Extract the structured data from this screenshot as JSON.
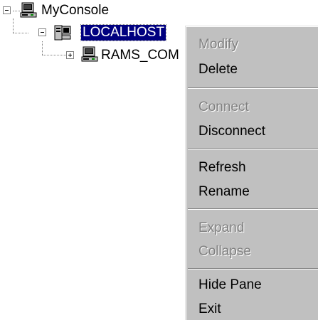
{
  "tree": {
    "root": {
      "label": "MyConsole",
      "expanded": true,
      "icon": "computer-icon"
    },
    "child": {
      "label": "LOCALHOST",
      "expanded": true,
      "selected": true,
      "icon": "server-icon"
    },
    "grandchild": {
      "label": "RAMS_COM",
      "expanded": false,
      "icon": "computer-icon"
    }
  },
  "menu": {
    "modify": "Modify",
    "delete": "Delete",
    "connect": "Connect",
    "disconnect": "Disconnect",
    "refresh": "Refresh",
    "rename": "Rename",
    "expand": "Expand",
    "collapse": "Collapse",
    "hide_pane": "Hide Pane",
    "exit": "Exit"
  },
  "colors": {
    "selection": "#000080",
    "menu_bg": "#c0c0c0",
    "disabled_text": "#808080"
  }
}
